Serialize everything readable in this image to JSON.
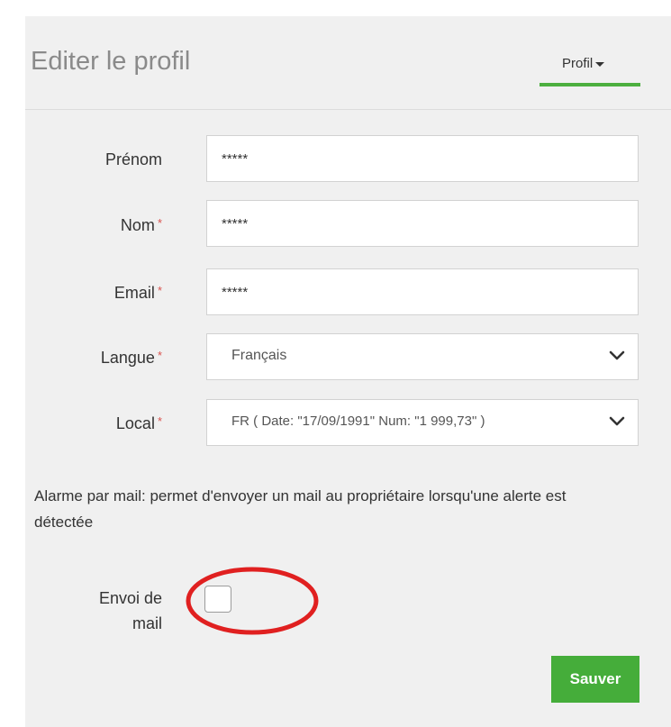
{
  "modal": {
    "title": "Editer le profil",
    "close_symbol": "×"
  },
  "tab": {
    "label": "Profil",
    "caret_icon": "caret-down-icon"
  },
  "form": {
    "required_marker": "*",
    "firstname": {
      "label": "Prénom",
      "value": "*****"
    },
    "lastname": {
      "label": "Nom",
      "value": "*****"
    },
    "email": {
      "label": "Email",
      "value": "*****"
    },
    "language": {
      "label": "Langue",
      "value": "Français"
    },
    "locale": {
      "label": "Local",
      "value": "FR ( Date: \"17/09/1991\" Num: \"1 999,73\" )"
    }
  },
  "info": {
    "text": "Alarme par mail: permet d'envoyer un mail au propriétaire lorsqu'une alerte est détectée"
  },
  "mail_option": {
    "label_line1": "Envoi de",
    "label_line2": "mail",
    "checked": false
  },
  "actions": {
    "save_label": "Sauver"
  },
  "colors": {
    "accent_green": "#45ad3a",
    "required_red": "#d9534f",
    "annotation_red": "#e02020",
    "panel_bg": "#f0f0f0"
  }
}
